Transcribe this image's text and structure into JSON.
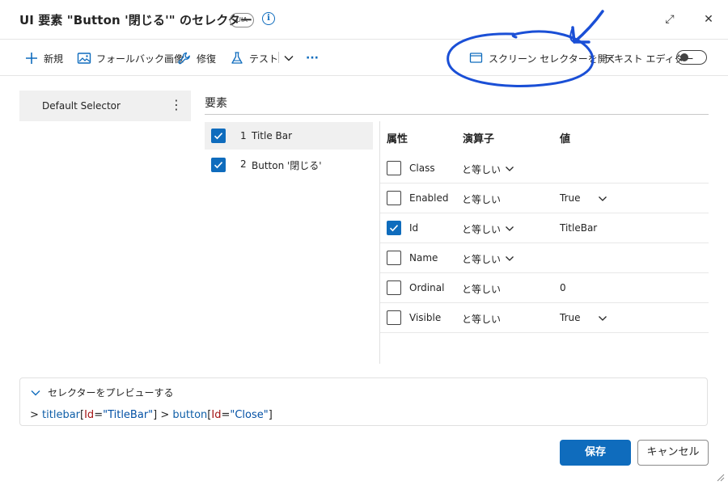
{
  "header": {
    "title": "UI 要素 \"Button '閉じる'\" のセレクター",
    "badge": "UIA",
    "info_glyph": "i",
    "restore_glyph": "⤢",
    "close_glyph": "✕"
  },
  "toolbar": {
    "new_label": "新規",
    "fallback_label": "フォールバック画像",
    "repair_label": "修復",
    "test_label": "テスト",
    "more_glyph": "···",
    "screen_selector_label": "スクリーン セレクターを開く",
    "text_editor_label": "テキスト エディター"
  },
  "selectors": {
    "items": [
      {
        "label": "Default Selector",
        "kebab": "⋮"
      }
    ]
  },
  "elements": {
    "title": "要素",
    "items": [
      {
        "index": "1",
        "label": "Title Bar",
        "checked": true
      },
      {
        "index": "2",
        "label": "Button '閉じる'",
        "checked": true
      }
    ]
  },
  "attributes": {
    "headers": {
      "name": "属性",
      "operator": "演算子",
      "value": "値"
    },
    "rows": [
      {
        "name": "Class",
        "operator": "と等しい",
        "value": "",
        "checked": false
      },
      {
        "name": "Enabled",
        "operator": "と等しい",
        "value": "True",
        "checked": false
      },
      {
        "name": "Id",
        "operator": "と等しい",
        "value": "TitleBar",
        "checked": true
      },
      {
        "name": "Name",
        "operator": "と等しい",
        "value": "",
        "checked": false
      },
      {
        "name": "Ordinal",
        "operator": "と等しい",
        "value": "0",
        "checked": false
      },
      {
        "name": "Visible",
        "operator": "と等しい",
        "value": "True",
        "checked": false
      }
    ]
  },
  "preview": {
    "label": "セレクターをプレビューする",
    "code": {
      "p1": "> ",
      "t1": "titlebar",
      "b1": "[",
      "a1": "Id",
      "e1": "=",
      "s1": "\"TitleBar\"",
      "b2": "]",
      "p2": " > ",
      "t2": "button",
      "b3": "[",
      "a2": "Id",
      "e2": "=",
      "s2": "\"Close\"",
      "b4": "]"
    }
  },
  "footer": {
    "save_label": "保存",
    "cancel_label": "キャンセル"
  },
  "colors": {
    "accent": "#0f6cbd",
    "annotation_ink": "#1a4fd6"
  }
}
